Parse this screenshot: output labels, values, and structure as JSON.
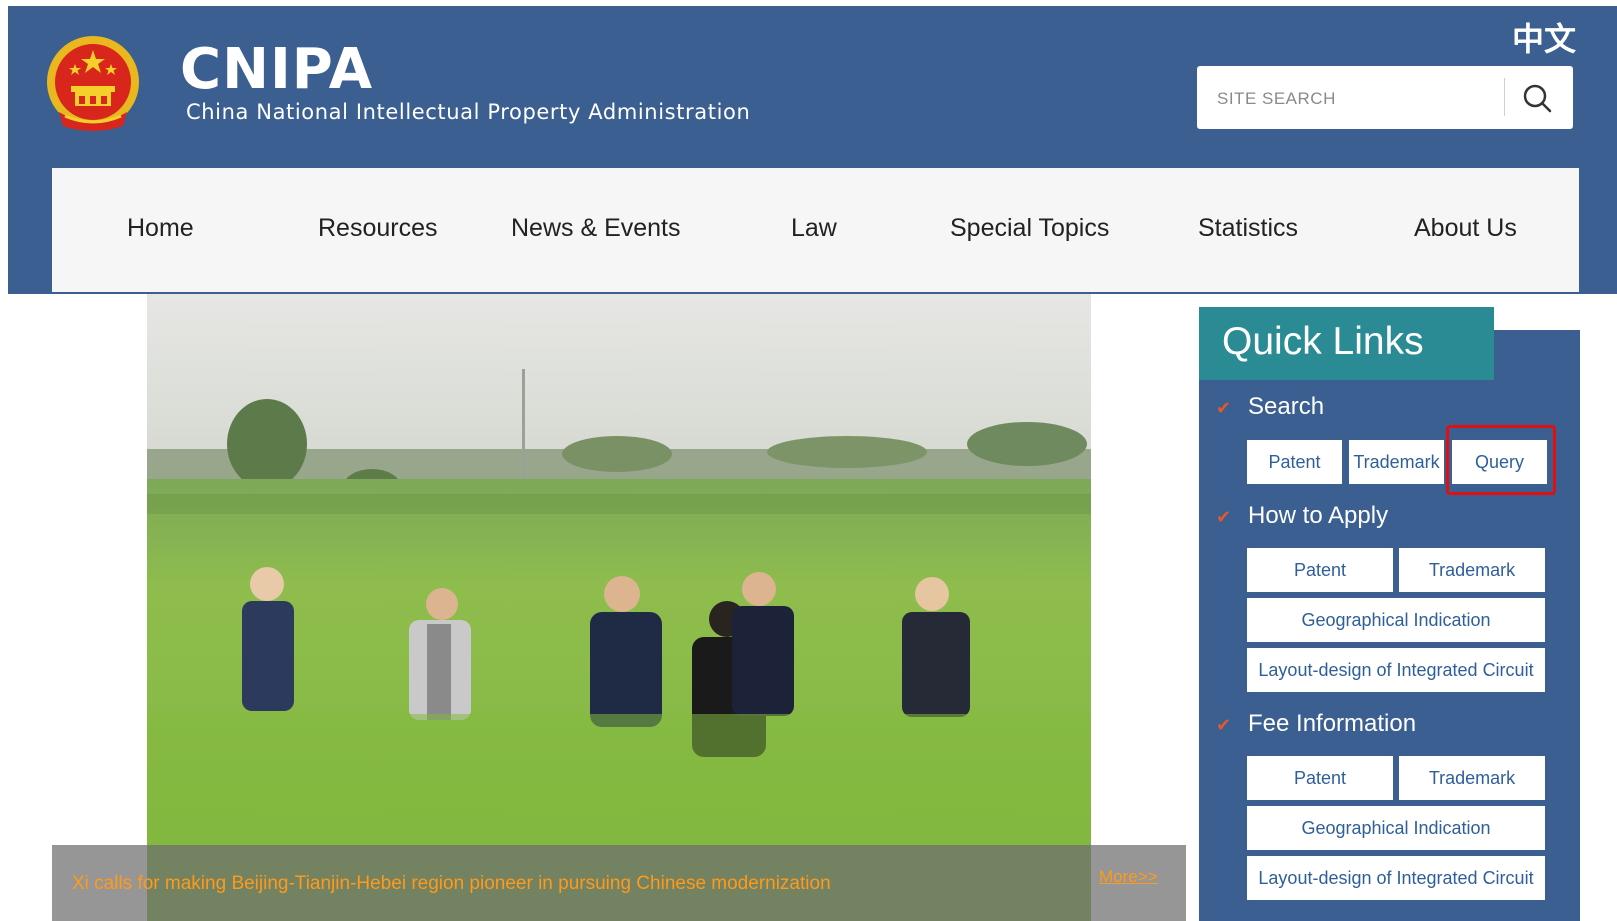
{
  "header": {
    "logo_title": "CNIPA",
    "logo_subtitle": "China National Intellectual Property Administration",
    "language_toggle": "中文",
    "search_placeholder": "SITE SEARCH"
  },
  "nav": {
    "items": [
      {
        "label": "Home"
      },
      {
        "label": "Resources"
      },
      {
        "label": "News & Events"
      },
      {
        "label": "Law"
      },
      {
        "label": "Special Topics"
      },
      {
        "label": "Statistics"
      },
      {
        "label": "About Us"
      }
    ]
  },
  "hero": {
    "caption": "Xi calls for making Beijing-Tianjin-Hebei region pioneer in pursuing Chinese modernization",
    "more_link": "More>>"
  },
  "quick_links": {
    "title": "Quick Links",
    "sections": [
      {
        "title": "Search",
        "buttons": [
          "Patent",
          "Trademark",
          "Query"
        ]
      },
      {
        "title": "How to Apply",
        "buttons": [
          "Patent",
          "Trademark",
          "Geographical Indication",
          "Layout-design of Integrated Circuit"
        ]
      },
      {
        "title": "Fee Information",
        "buttons": [
          "Patent",
          "Trademark",
          "Geographical Indication",
          "Layout-design of Integrated Circuit"
        ]
      }
    ]
  },
  "colors": {
    "header_bg": "#3b5f90",
    "quicklinks_header": "#2a8b95",
    "caption_text": "#ff9a1a",
    "highlight": "#e01010"
  }
}
